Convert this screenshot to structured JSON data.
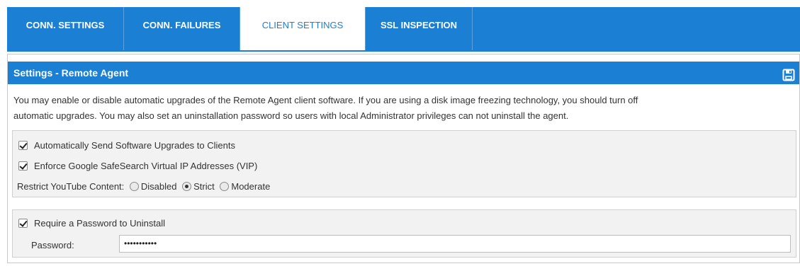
{
  "tabs": [
    {
      "label": "CONN. SETTINGS",
      "active": false
    },
    {
      "label": "CONN. FAILURES",
      "active": false
    },
    {
      "label": "CLIENT SETTINGS",
      "active": true
    },
    {
      "label": "SSL INSPECTION",
      "active": false
    }
  ],
  "panel": {
    "title": "Settings - Remote Agent",
    "save_icon": "save-icon",
    "description_line1": "You may enable or disable automatic upgrades of the Remote Agent client software. If you are using a disk image freezing technology, you should turn off",
    "description_line2": "automatic upgrades. You may also set an uninstallation password so users with local Administrator privileges can not uninstall the agent."
  },
  "options": {
    "auto_upgrades": {
      "label": "Automatically Send Software Upgrades to Clients",
      "checked": true
    },
    "safesearch": {
      "label": "Enforce Google SafeSearch Virtual IP Addresses (VIP)",
      "checked": true
    },
    "youtube": {
      "label": "Restrict YouTube Content:",
      "options": [
        "Disabled",
        "Strict",
        "Moderate"
      ],
      "selected": "Strict"
    }
  },
  "password": {
    "require_label": "Require a Password to Uninstall",
    "require_checked": true,
    "field_label": "Password:",
    "value": "•••••••••••"
  },
  "colors": {
    "accent": "#1b7fd4",
    "box_bg": "#f2f2f2"
  }
}
